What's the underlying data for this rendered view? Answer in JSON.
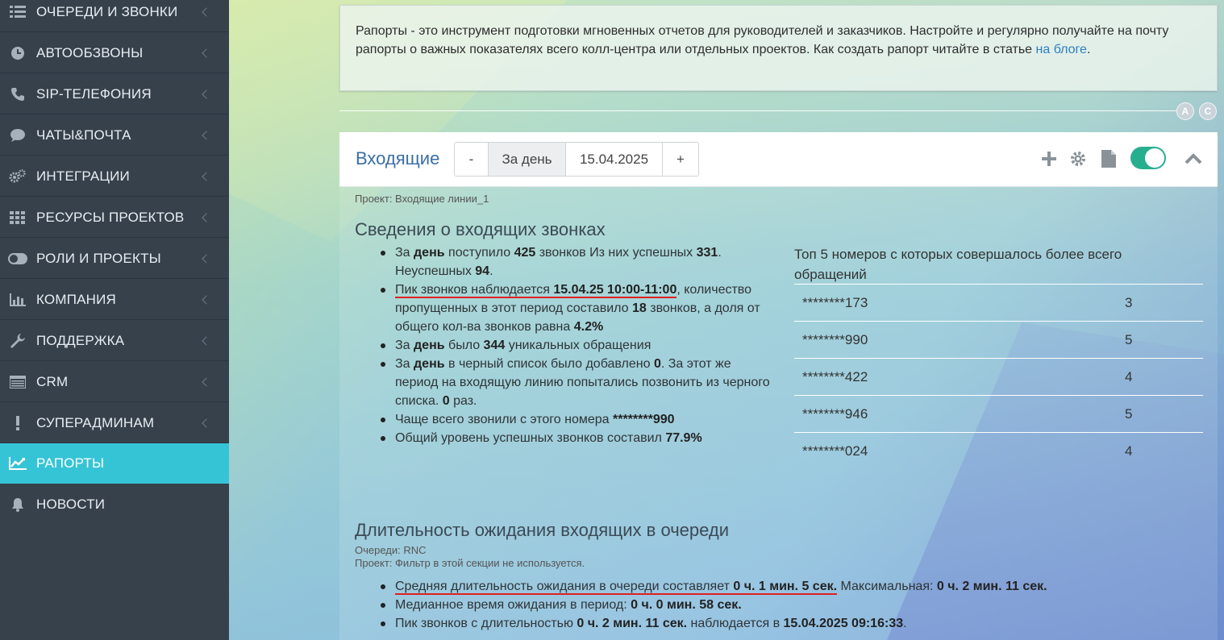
{
  "sidebar": {
    "items": [
      {
        "label": "ОЧЕРЕДИ И ЗВОНКИ",
        "icon": "list-icon"
      },
      {
        "label": "АВТООБЗВОНЫ",
        "icon": "clock-icon"
      },
      {
        "label": "SIP-ТЕЛЕФОНИЯ",
        "icon": "phone-icon"
      },
      {
        "label": "ЧАТЫ&ПОЧТА",
        "icon": "chat-icon"
      },
      {
        "label": "ИНТЕГРАЦИИ",
        "icon": "cogs-icon"
      },
      {
        "label": "РЕСУРСЫ ПРОЕКТОВ",
        "icon": "grid-icon"
      },
      {
        "label": "РОЛИ И ПРОЕКТЫ",
        "icon": "toggle-icon"
      },
      {
        "label": "КОМПАНИЯ",
        "icon": "bar-chart-icon"
      },
      {
        "label": "ПОДДЕРЖКА",
        "icon": "wrench-icon"
      },
      {
        "label": "CRM",
        "icon": "table-icon"
      },
      {
        "label": "СУПЕРАДМИНАМ",
        "icon": "exclamation-icon"
      },
      {
        "label": "РАПОРТЫ",
        "icon": "line-chart-icon"
      },
      {
        "label": "НОВОСТИ",
        "icon": "bell-icon"
      }
    ]
  },
  "info": {
    "text": "Рапорты - это инструмент подготовки мгновенных отчетов для руководителей и заказчиков. Настройте и регулярно получайте на почту рапорты о важных показателях всего колл-центра или отдельных проектов. Как создать рапорт читайте в статье ",
    "link": "на блоге",
    "end": "."
  },
  "circles": {
    "a": "A",
    "c": "C"
  },
  "panel": {
    "title": "Входящие",
    "minus": "-",
    "period": "За день",
    "date": "15.04.2025",
    "plus": "+",
    "project": "Проект: Входящие линии_1"
  },
  "section1": {
    "title": "Сведения о входящих звонках",
    "b1": {
      "t1": "За ",
      "b1": "день",
      "t2": " поступило ",
      "b2": "425",
      "t3": " звонков Из них успешных ",
      "b3": "331",
      "t4": ". Неуспешных ",
      "b4": "94",
      "t5": "."
    },
    "b2": {
      "t1": "Пик звонков наблюдается ",
      "b1": "15.04.25 10:00-11:00",
      "t2": ", количество пропущенных в этот период составило ",
      "b2": "18",
      "t3": " звонков, а доля от общего кол-ва звонков равна ",
      "b3": "4.2%"
    },
    "b3": {
      "t1": "За ",
      "b1": "день",
      "t2": " было ",
      "b2": "344",
      "t3": " уникальных обращения"
    },
    "b4": {
      "t1": "За ",
      "b1": "день",
      "t2": " в черный список было добавлено ",
      "b2": "0",
      "t3": ". За этот же период на входящую линию попытались позвонить из черного списка. ",
      "b3": "0",
      "t4": " раз."
    },
    "b5": {
      "t1": "Чаще всего звонили с этого номера ",
      "b1": "********990"
    },
    "b6": {
      "t1": "Общий уровень успешных звонков составил ",
      "b1": "77.9%"
    }
  },
  "top5": {
    "title": "Топ 5 номеров с которых совершалось более всего обращений",
    "rows": [
      {
        "number": "********173",
        "count": "3"
      },
      {
        "number": "********990",
        "count": "5"
      },
      {
        "number": "********422",
        "count": "4"
      },
      {
        "number": "********946",
        "count": "5"
      },
      {
        "number": "********024",
        "count": "4"
      }
    ]
  },
  "section2": {
    "title": "Длительность ожидания входящих в очереди",
    "queues": "Очереди: RNC",
    "project": "Проект: Фильтр в этой секции не используется.",
    "b1": {
      "t1": "Средняя длительность ожидания в очереди составляет ",
      "b1": "0 ч. 1 мин. 5 сек.",
      "t2": " Максимальная: ",
      "b2": "0 ч. 2 мин. 11 сек."
    },
    "b2": {
      "t1": "Медианное время ожидания в период: ",
      "b1": "0 ч. 0 мин. 58 сек."
    },
    "b3": {
      "t1": "Пик звонков с длительностью ",
      "b1": "0 ч. 2 мин. 11 сек.",
      "t2": " наблюдается в ",
      "b2": "15.04.2025 09:16:33",
      "t3": "."
    }
  },
  "colors": {
    "sidebar": "#36414c",
    "active": "#35c4d6",
    "toggle": "#27ae8f",
    "title": "#3a6ea5",
    "underline": "#e02020"
  }
}
